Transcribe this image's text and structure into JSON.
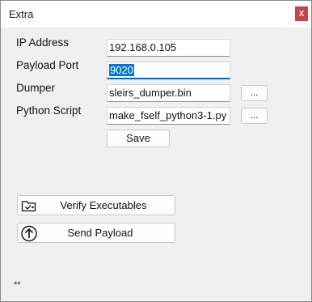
{
  "window": {
    "title": "Extra",
    "close_label": "x"
  },
  "form": {
    "ip_label": "IP Address",
    "ip_value": "192.168.0.105",
    "port_label": "Payload Port",
    "port_value": "9020",
    "dumper_label": "Dumper",
    "dumper_value": "sleirs_dumper.bin",
    "dumper_browse_label": "...",
    "script_label": "Python Script",
    "script_value": "make_fself_python3-1.py",
    "script_browse_label": "...",
    "save_label": "Save"
  },
  "actions": {
    "verify_label": "Verify Executables",
    "verify_icon": "folder-check-icon",
    "send_label": "Send Payload",
    "send_icon": "upload-arrow-icon"
  },
  "status": {
    "text": "**"
  }
}
